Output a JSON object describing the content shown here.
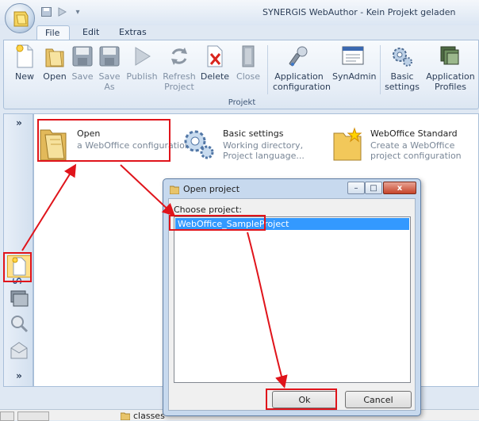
{
  "window": {
    "title": "SYNERGIS WebAuthor - Kein Projekt geladen"
  },
  "tabs": [
    {
      "label": "File",
      "active": true
    },
    {
      "label": "Edit",
      "active": false
    },
    {
      "label": "Extras",
      "active": false
    }
  ],
  "ribbon": {
    "buttons": [
      {
        "label": "New",
        "icon": "new-file-icon",
        "disabled": false
      },
      {
        "label": "Open",
        "icon": "open-folder-icon",
        "disabled": false
      },
      {
        "label": "Save",
        "icon": "save-icon",
        "disabled": true
      },
      {
        "label": "Save As",
        "icon": "save-as-icon",
        "disabled": true
      },
      {
        "label": "Publish",
        "icon": "publish-icon",
        "disabled": true
      },
      {
        "label": "Refresh Project",
        "icon": "refresh-icon",
        "disabled": true
      },
      {
        "label": "Delete",
        "icon": "delete-icon",
        "disabled": false
      },
      {
        "label": "Close",
        "icon": "close-book-icon",
        "disabled": true
      },
      {
        "label": "Application configuration",
        "icon": "wrench-icon",
        "disabled": false
      },
      {
        "label": "SynAdmin",
        "icon": "admin-window-icon",
        "disabled": false
      },
      {
        "label": "Basic settings",
        "icon": "gears-icon",
        "disabled": false
      },
      {
        "label": "Application Profiles",
        "icon": "profiles-icon",
        "disabled": false
      }
    ],
    "group_label": "Projekt"
  },
  "sidebar": {
    "start_label": "Start",
    "expand": "»",
    "expand_bottom": "»"
  },
  "tiles": [
    {
      "title": "Open",
      "subtitle": "a WebOffice configuration",
      "subtitle2": ""
    },
    {
      "title": "Basic settings",
      "subtitle": "Working directory,",
      "subtitle2": "Project language..."
    },
    {
      "title": "WebOffice Standard",
      "subtitle": "Create a WebOffice",
      "subtitle2": "project configuration"
    }
  ],
  "dialog": {
    "title": "Open project",
    "label": "Choose project:",
    "items": [
      "WebOffice_SampleProject"
    ],
    "ok_label": "Ok",
    "cancel_label": "Cancel",
    "min": "–",
    "max": "□",
    "close": "x"
  },
  "taskbar": {
    "folder_label": "classes"
  },
  "colors": {
    "annotation": "#e0141b",
    "selection": "#3399ff",
    "accent": "#2a4a85"
  }
}
